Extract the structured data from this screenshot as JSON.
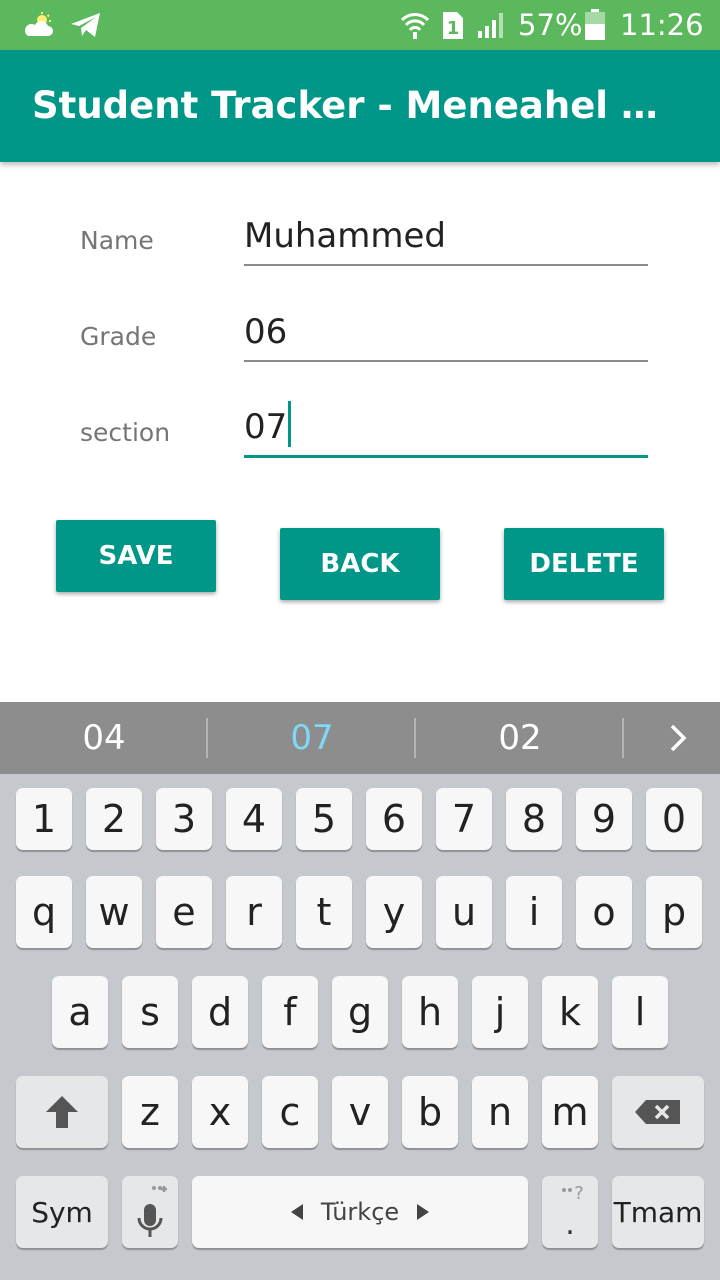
{
  "status_bar": {
    "battery_percent": "57%",
    "time": "11:26",
    "sim_slot": "1"
  },
  "app_bar": {
    "title": "Student Tracker - Meneahel school"
  },
  "form": {
    "name_label": "Name",
    "name_value": "Muhammed",
    "grade_label": "Grade",
    "grade_value": "06",
    "section_label": "section",
    "section_value": "07"
  },
  "buttons": {
    "save": "SAVE",
    "back": "BACK",
    "delete": "DELETE"
  },
  "keyboard": {
    "suggestions": [
      "04",
      "07",
      "02"
    ],
    "number_row": [
      "1",
      "2",
      "3",
      "4",
      "5",
      "6",
      "7",
      "8",
      "9",
      "0"
    ],
    "row1": [
      "q",
      "w",
      "e",
      "r",
      "t",
      "y",
      "u",
      "i",
      "o",
      "p"
    ],
    "row2": [
      "a",
      "s",
      "d",
      "f",
      "g",
      "h",
      "j",
      "k",
      "l"
    ],
    "row3": [
      "z",
      "x",
      "c",
      "v",
      "b",
      "n",
      "m"
    ],
    "sym_label": "Sym",
    "space_label": "Türkçe",
    "enter_label": "Tmam",
    "period_key": "."
  },
  "colors": {
    "status_bar": "#5cb85c",
    "primary": "#009688",
    "suggestion_highlight": "#7fd8f5",
    "keyboard_bg": "#c5c8cc"
  }
}
